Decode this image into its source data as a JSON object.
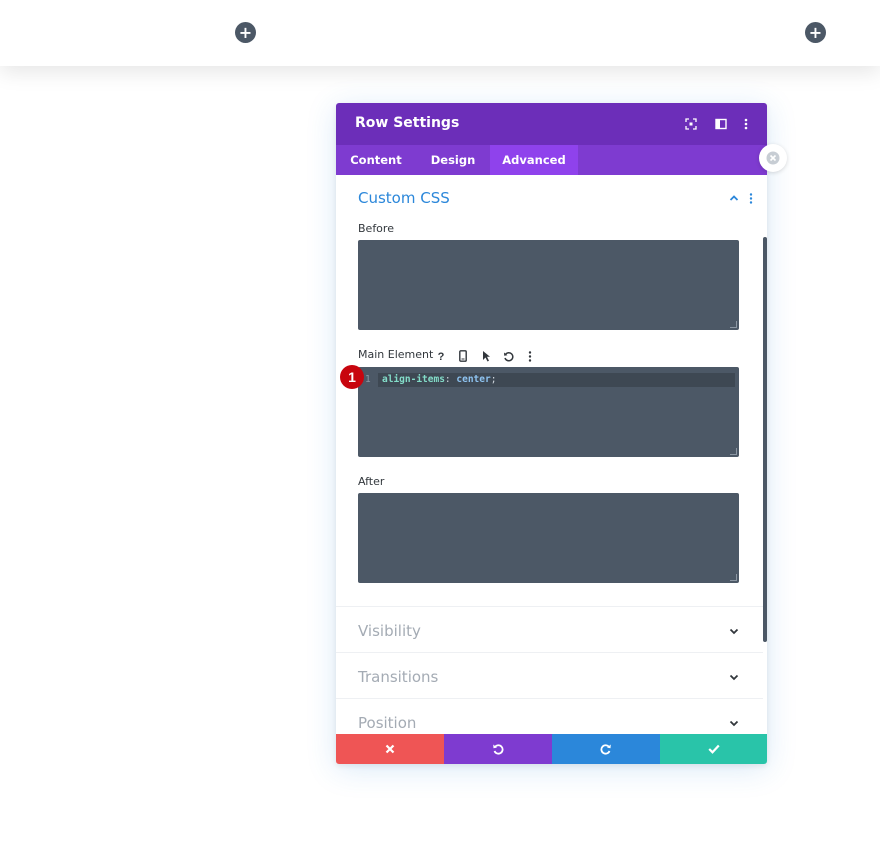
{
  "builder": {
    "add_row_icon": "plus-icon",
    "accent_color": "#2b87da"
  },
  "modal": {
    "title": "Row Settings",
    "header_icons": [
      "expand-icon",
      "sidebar-toggle-icon",
      "more-vertical-icon"
    ],
    "tabs": [
      {
        "label": "Content",
        "active": false
      },
      {
        "label": "Design",
        "active": false
      },
      {
        "label": "Advanced",
        "active": true
      }
    ],
    "header_color": "#6c2eb9",
    "tabs_color": "#7e3bd0"
  },
  "custom_css": {
    "title": "Custom CSS",
    "before_label": "Before",
    "main_label": "Main Element",
    "main_toolbar_icons": [
      "help-icon",
      "mobile-icon",
      "hover-cursor-icon",
      "reset-icon",
      "more-vertical-icon"
    ],
    "after_label": "After",
    "code": {
      "line_number": "1",
      "property": "align-items",
      "separator": ": ",
      "value": "center",
      "terminator": ";"
    },
    "step_badge": "1"
  },
  "sections": {
    "visibility": "Visibility",
    "transitions": "Transitions",
    "position": "Position"
  },
  "footer": {
    "buttons": [
      {
        "name": "cancel",
        "icon": "close-icon",
        "color": "#ef5555"
      },
      {
        "name": "undo",
        "icon": "undo-icon",
        "color": "#7e3bd0"
      },
      {
        "name": "redo",
        "icon": "redo-icon",
        "color": "#2b87da"
      },
      {
        "name": "save",
        "icon": "check-icon",
        "color": "#29c4a9"
      }
    ]
  }
}
